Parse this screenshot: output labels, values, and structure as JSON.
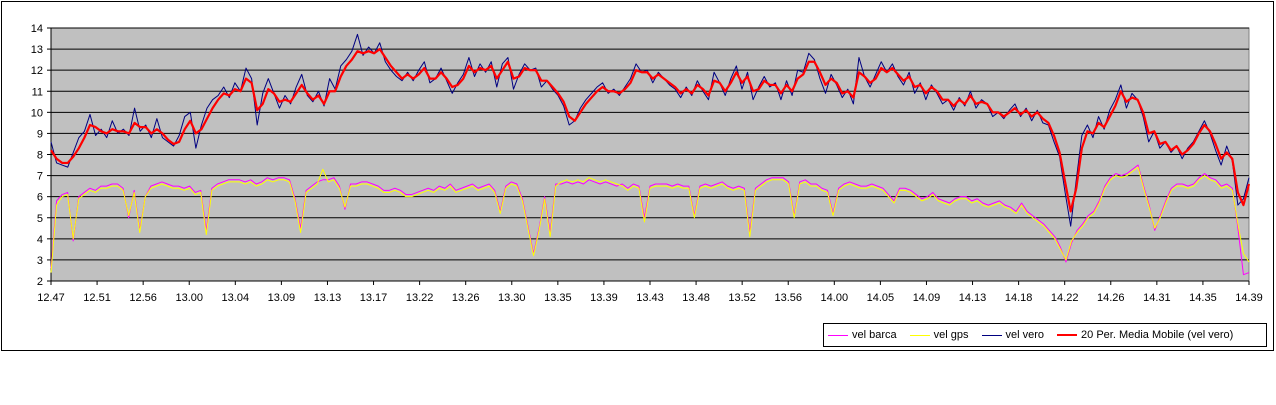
{
  "chart_data": {
    "type": "line",
    "title": "",
    "xlabel": "",
    "ylabel": "",
    "ylim": [
      2,
      14
    ],
    "yticks": [
      2,
      3,
      4,
      5,
      6,
      7,
      8,
      9,
      10,
      11,
      12,
      13,
      14
    ],
    "x_tick_labels": [
      "12.47",
      "12.51",
      "12.56",
      "13.00",
      "13.04",
      "13.09",
      "13.13",
      "13.17",
      "13.22",
      "13.26",
      "13.30",
      "13.35",
      "13.39",
      "13.43",
      "13.48",
      "13.52",
      "13.56",
      "14.00",
      "14.05",
      "14.09",
      "14.13",
      "14.18",
      "14.22",
      "14.26",
      "14.31",
      "14.35",
      "14.39"
    ],
    "grid": "horizontal",
    "plot_background": "#c0c0c0",
    "legend_position": "bottom-right",
    "series": [
      {
        "name": "vel barca",
        "color": "#ff00ff",
        "values": [
          2.6,
          5.8,
          6.1,
          6.2,
          3.9,
          6.0,
          6.2,
          6.4,
          6.3,
          6.5,
          6.5,
          6.6,
          6.6,
          6.4,
          5.0,
          6.3,
          4.4,
          6.0,
          6.5,
          6.6,
          6.7,
          6.6,
          6.5,
          6.5,
          6.4,
          6.5,
          6.2,
          6.3,
          4.4,
          6.4,
          6.6,
          6.7,
          6.8,
          6.8,
          6.8,
          6.7,
          6.8,
          6.6,
          6.7,
          6.9,
          6.8,
          6.9,
          6.9,
          6.8,
          5.9,
          4.5,
          6.3,
          6.5,
          6.7,
          6.8,
          6.8,
          6.9,
          6.5,
          5.4,
          6.6,
          6.6,
          6.7,
          6.7,
          6.6,
          6.5,
          6.3,
          6.3,
          6.4,
          6.3,
          6.1,
          6.1,
          6.2,
          6.3,
          6.4,
          6.3,
          6.5,
          6.4,
          6.6,
          6.3,
          6.4,
          6.5,
          6.6,
          6.4,
          6.5,
          6.6,
          6.3,
          5.3,
          6.5,
          6.7,
          6.6,
          5.9,
          4.6,
          3.3,
          4.5,
          6.0,
          4.3,
          6.6,
          6.6,
          6.7,
          6.6,
          6.7,
          6.6,
          6.8,
          6.7,
          6.6,
          6.7,
          6.6,
          6.5,
          6.6,
          6.4,
          6.6,
          6.5,
          5.0,
          6.5,
          6.6,
          6.6,
          6.6,
          6.5,
          6.6,
          6.5,
          6.5,
          5.1,
          6.5,
          6.6,
          6.5,
          6.6,
          6.7,
          6.5,
          6.4,
          6.5,
          6.4,
          4.3,
          6.4,
          6.6,
          6.8,
          6.9,
          6.9,
          6.9,
          6.7,
          5.1,
          6.7,
          6.8,
          6.6,
          6.6,
          6.4,
          6.3,
          5.2,
          6.4,
          6.6,
          6.7,
          6.6,
          6.5,
          6.5,
          6.6,
          6.5,
          6.4,
          6.1,
          5.8,
          6.4,
          6.4,
          6.3,
          6.1,
          5.9,
          6.0,
          6.2,
          5.9,
          5.8,
          5.7,
          5.9,
          6.0,
          6.0,
          5.8,
          5.9,
          5.7,
          5.6,
          5.7,
          5.8,
          5.6,
          5.5,
          5.3,
          5.7,
          5.3,
          5.1,
          4.9,
          4.7,
          4.4,
          4.1,
          3.6,
          2.9,
          3.8,
          4.4,
          4.7,
          5.1,
          5.3,
          5.8,
          6.5,
          6.9,
          7.1,
          7.0,
          7.1,
          7.3,
          7.5,
          6.5,
          5.6,
          4.4,
          5.1,
          5.8,
          6.4,
          6.6,
          6.6,
          6.5,
          6.6,
          6.9,
          7.1,
          6.9,
          6.8,
          6.5,
          6.6,
          6.4,
          4.5,
          2.3,
          2.4
        ]
      },
      {
        "name": "vel gps",
        "color": "#ffff00",
        "values": [
          2.4,
          5.6,
          6.0,
          6.1,
          4.0,
          5.9,
          6.1,
          6.3,
          6.2,
          6.4,
          6.4,
          6.5,
          6.5,
          6.3,
          5.1,
          6.2,
          4.3,
          6.0,
          6.4,
          6.5,
          6.6,
          6.5,
          6.4,
          6.4,
          6.3,
          6.4,
          6.1,
          6.2,
          4.2,
          6.3,
          6.5,
          6.6,
          6.7,
          6.7,
          6.7,
          6.6,
          6.7,
          6.5,
          6.6,
          6.8,
          6.7,
          6.8,
          6.8,
          6.7,
          5.8,
          4.3,
          6.2,
          6.4,
          6.6,
          7.3,
          6.7,
          6.8,
          6.4,
          5.5,
          6.5,
          6.5,
          6.6,
          6.6,
          6.5,
          6.4,
          6.2,
          6.2,
          6.3,
          6.2,
          6.0,
          6.0,
          6.1,
          6.2,
          6.3,
          6.2,
          6.4,
          6.3,
          6.5,
          6.2,
          6.3,
          6.4,
          6.5,
          6.3,
          6.4,
          6.5,
          6.2,
          5.2,
          6.4,
          6.6,
          6.5,
          5.8,
          4.5,
          3.2,
          4.4,
          5.9,
          4.1,
          6.5,
          6.7,
          6.8,
          6.7,
          6.8,
          6.7,
          6.9,
          6.8,
          6.7,
          6.8,
          6.7,
          6.6,
          6.5,
          6.3,
          6.5,
          6.4,
          4.8,
          6.4,
          6.5,
          6.5,
          6.5,
          6.4,
          6.5,
          6.4,
          6.4,
          5.0,
          6.4,
          6.5,
          6.4,
          6.5,
          6.6,
          6.4,
          6.3,
          6.4,
          6.3,
          4.1,
          6.3,
          6.5,
          6.7,
          6.8,
          6.8,
          6.8,
          6.6,
          5.0,
          6.6,
          6.7,
          6.5,
          6.5,
          6.3,
          6.2,
          5.1,
          6.3,
          6.5,
          6.6,
          6.5,
          6.4,
          6.4,
          6.5,
          6.4,
          6.3,
          6.0,
          5.7,
          6.3,
          6.3,
          6.2,
          6.0,
          5.8,
          5.9,
          6.1,
          5.8,
          5.7,
          5.6,
          5.8,
          5.9,
          5.9,
          5.7,
          5.8,
          5.6,
          5.5,
          5.6,
          5.7,
          5.5,
          5.4,
          5.2,
          5.6,
          5.2,
          5.0,
          4.8,
          4.6,
          4.3,
          4.0,
          3.5,
          3.0,
          3.9,
          4.3,
          4.6,
          5.0,
          5.2,
          5.7,
          6.4,
          6.8,
          7.0,
          6.9,
          7.0,
          7.2,
          7.4,
          6.4,
          5.5,
          4.5,
          5.0,
          5.7,
          6.3,
          6.5,
          6.5,
          6.4,
          6.5,
          6.8,
          7.0,
          6.8,
          6.7,
          6.4,
          6.5,
          6.3,
          4.7,
          3.3,
          2.9
        ]
      },
      {
        "name": "vel vero",
        "color": "#000080",
        "values": [
          8.6,
          7.6,
          7.5,
          7.4,
          8.1,
          8.8,
          9.1,
          9.9,
          8.9,
          9.2,
          8.8,
          9.6,
          9.0,
          9.2,
          8.9,
          10.2,
          9.1,
          9.4,
          8.8,
          9.7,
          8.8,
          8.6,
          8.4,
          8.9,
          9.8,
          10.0,
          8.3,
          9.4,
          10.2,
          10.6,
          10.8,
          11.2,
          10.7,
          11.4,
          11.0,
          12.1,
          11.6,
          9.4,
          10.9,
          11.6,
          10.9,
          10.2,
          10.8,
          10.4,
          11.2,
          11.8,
          10.8,
          10.5,
          11.0,
          10.3,
          11.6,
          11.1,
          12.2,
          12.5,
          12.9,
          13.7,
          12.7,
          13.1,
          12.8,
          13.3,
          12.4,
          12.0,
          11.7,
          11.5,
          11.9,
          11.5,
          12.0,
          12.4,
          11.4,
          11.6,
          12.1,
          11.5,
          10.9,
          11.4,
          11.8,
          12.6,
          11.7,
          12.3,
          11.9,
          12.4,
          11.2,
          12.3,
          12.6,
          11.1,
          11.8,
          12.3,
          12.0,
          12.1,
          11.2,
          11.5,
          11.1,
          10.8,
          10.3,
          9.4,
          9.6,
          10.2,
          10.6,
          10.9,
          11.2,
          11.4,
          10.9,
          11.1,
          10.8,
          11.2,
          11.6,
          12.3,
          11.9,
          12.0,
          11.4,
          11.9,
          11.6,
          11.3,
          11.1,
          10.7,
          11.2,
          10.8,
          11.5,
          11.0,
          10.6,
          11.9,
          11.4,
          10.8,
          11.6,
          12.2,
          11.1,
          11.9,
          10.6,
          11.2,
          11.7,
          11.2,
          11.4,
          10.6,
          11.5,
          10.8,
          12.0,
          11.9,
          12.8,
          12.5,
          11.6,
          10.9,
          11.8,
          11.3,
          10.7,
          11.1,
          10.4,
          12.6,
          11.7,
          11.2,
          11.8,
          12.4,
          11.9,
          12.3,
          11.7,
          11.3,
          11.9,
          10.9,
          11.4,
          10.6,
          11.3,
          10.9,
          10.4,
          10.6,
          10.1,
          10.7,
          10.3,
          11.0,
          10.2,
          10.6,
          10.4,
          9.8,
          10.0,
          9.7,
          10.1,
          10.4,
          9.8,
          10.2,
          9.6,
          10.1,
          9.5,
          9.4,
          8.6,
          7.9,
          6.2,
          4.6,
          6.8,
          8.9,
          9.4,
          8.8,
          9.8,
          9.2,
          10.1,
          10.6,
          11.3,
          10.2,
          10.9,
          10.6,
          9.8,
          8.6,
          9.1,
          8.3,
          8.6,
          8.1,
          8.4,
          7.8,
          8.3,
          8.6,
          9.1,
          9.6,
          9.0,
          8.2,
          7.5,
          8.4,
          7.7,
          5.6,
          5.9,
          6.9
        ]
      },
      {
        "name": "20 Per. Media Mobile (vel vero)",
        "color": "#ff0000",
        "values": [
          8.2,
          7.8,
          7.6,
          7.6,
          7.9,
          8.3,
          8.8,
          9.4,
          9.3,
          9.1,
          9.0,
          9.2,
          9.1,
          9.1,
          9.0,
          9.5,
          9.3,
          9.3,
          9.0,
          9.2,
          9.0,
          8.7,
          8.5,
          8.6,
          9.2,
          9.6,
          9.0,
          9.2,
          9.7,
          10.2,
          10.6,
          10.9,
          10.8,
          11.1,
          11.0,
          11.6,
          11.4,
          10.1,
          10.4,
          11.1,
          10.9,
          10.5,
          10.6,
          10.5,
          10.9,
          11.3,
          10.9,
          10.6,
          10.8,
          10.4,
          11.0,
          11.0,
          11.7,
          12.2,
          12.5,
          12.9,
          12.8,
          12.9,
          12.8,
          13.0,
          12.6,
          12.2,
          11.9,
          11.6,
          11.8,
          11.6,
          11.8,
          12.1,
          11.6,
          11.6,
          11.9,
          11.6,
          11.2,
          11.3,
          11.6,
          12.2,
          11.9,
          12.1,
          12.0,
          12.2,
          11.6,
          12.0,
          12.4,
          11.6,
          11.7,
          12.1,
          12.0,
          12.0,
          11.5,
          11.5,
          11.2,
          10.9,
          10.5,
          9.8,
          9.6,
          10.0,
          10.4,
          10.7,
          11.0,
          11.2,
          11.0,
          11.0,
          10.9,
          11.1,
          11.4,
          12.0,
          11.9,
          11.9,
          11.6,
          11.8,
          11.6,
          11.4,
          11.2,
          10.9,
          11.1,
          10.9,
          11.3,
          11.1,
          10.8,
          11.5,
          11.4,
          11.0,
          11.4,
          11.9,
          11.4,
          11.7,
          11.0,
          11.1,
          11.5,
          11.3,
          11.3,
          10.9,
          11.3,
          11.0,
          11.6,
          11.8,
          12.4,
          12.4,
          11.9,
          11.3,
          11.6,
          11.4,
          10.9,
          11.0,
          10.7,
          11.9,
          11.7,
          11.4,
          11.6,
          12.1,
          11.9,
          12.1,
          11.8,
          11.5,
          11.7,
          11.2,
          11.3,
          10.9,
          11.2,
          11.0,
          10.6,
          10.6,
          10.3,
          10.6,
          10.4,
          10.8,
          10.4,
          10.5,
          10.4,
          10.0,
          10.0,
          9.8,
          10.0,
          10.2,
          9.9,
          10.1,
          9.8,
          10.0,
          9.7,
          9.5,
          8.9,
          8.1,
          6.7,
          5.3,
          6.4,
          8.3,
          9.1,
          9.0,
          9.5,
          9.3,
          9.8,
          10.3,
          11.0,
          10.5,
          10.7,
          10.6,
          10.0,
          9.0,
          9.1,
          8.5,
          8.6,
          8.2,
          8.4,
          8.0,
          8.2,
          8.5,
          9.0,
          9.4,
          9.1,
          8.5,
          7.8,
          8.1,
          7.8,
          6.2,
          5.6,
          6.6
        ]
      }
    ]
  }
}
